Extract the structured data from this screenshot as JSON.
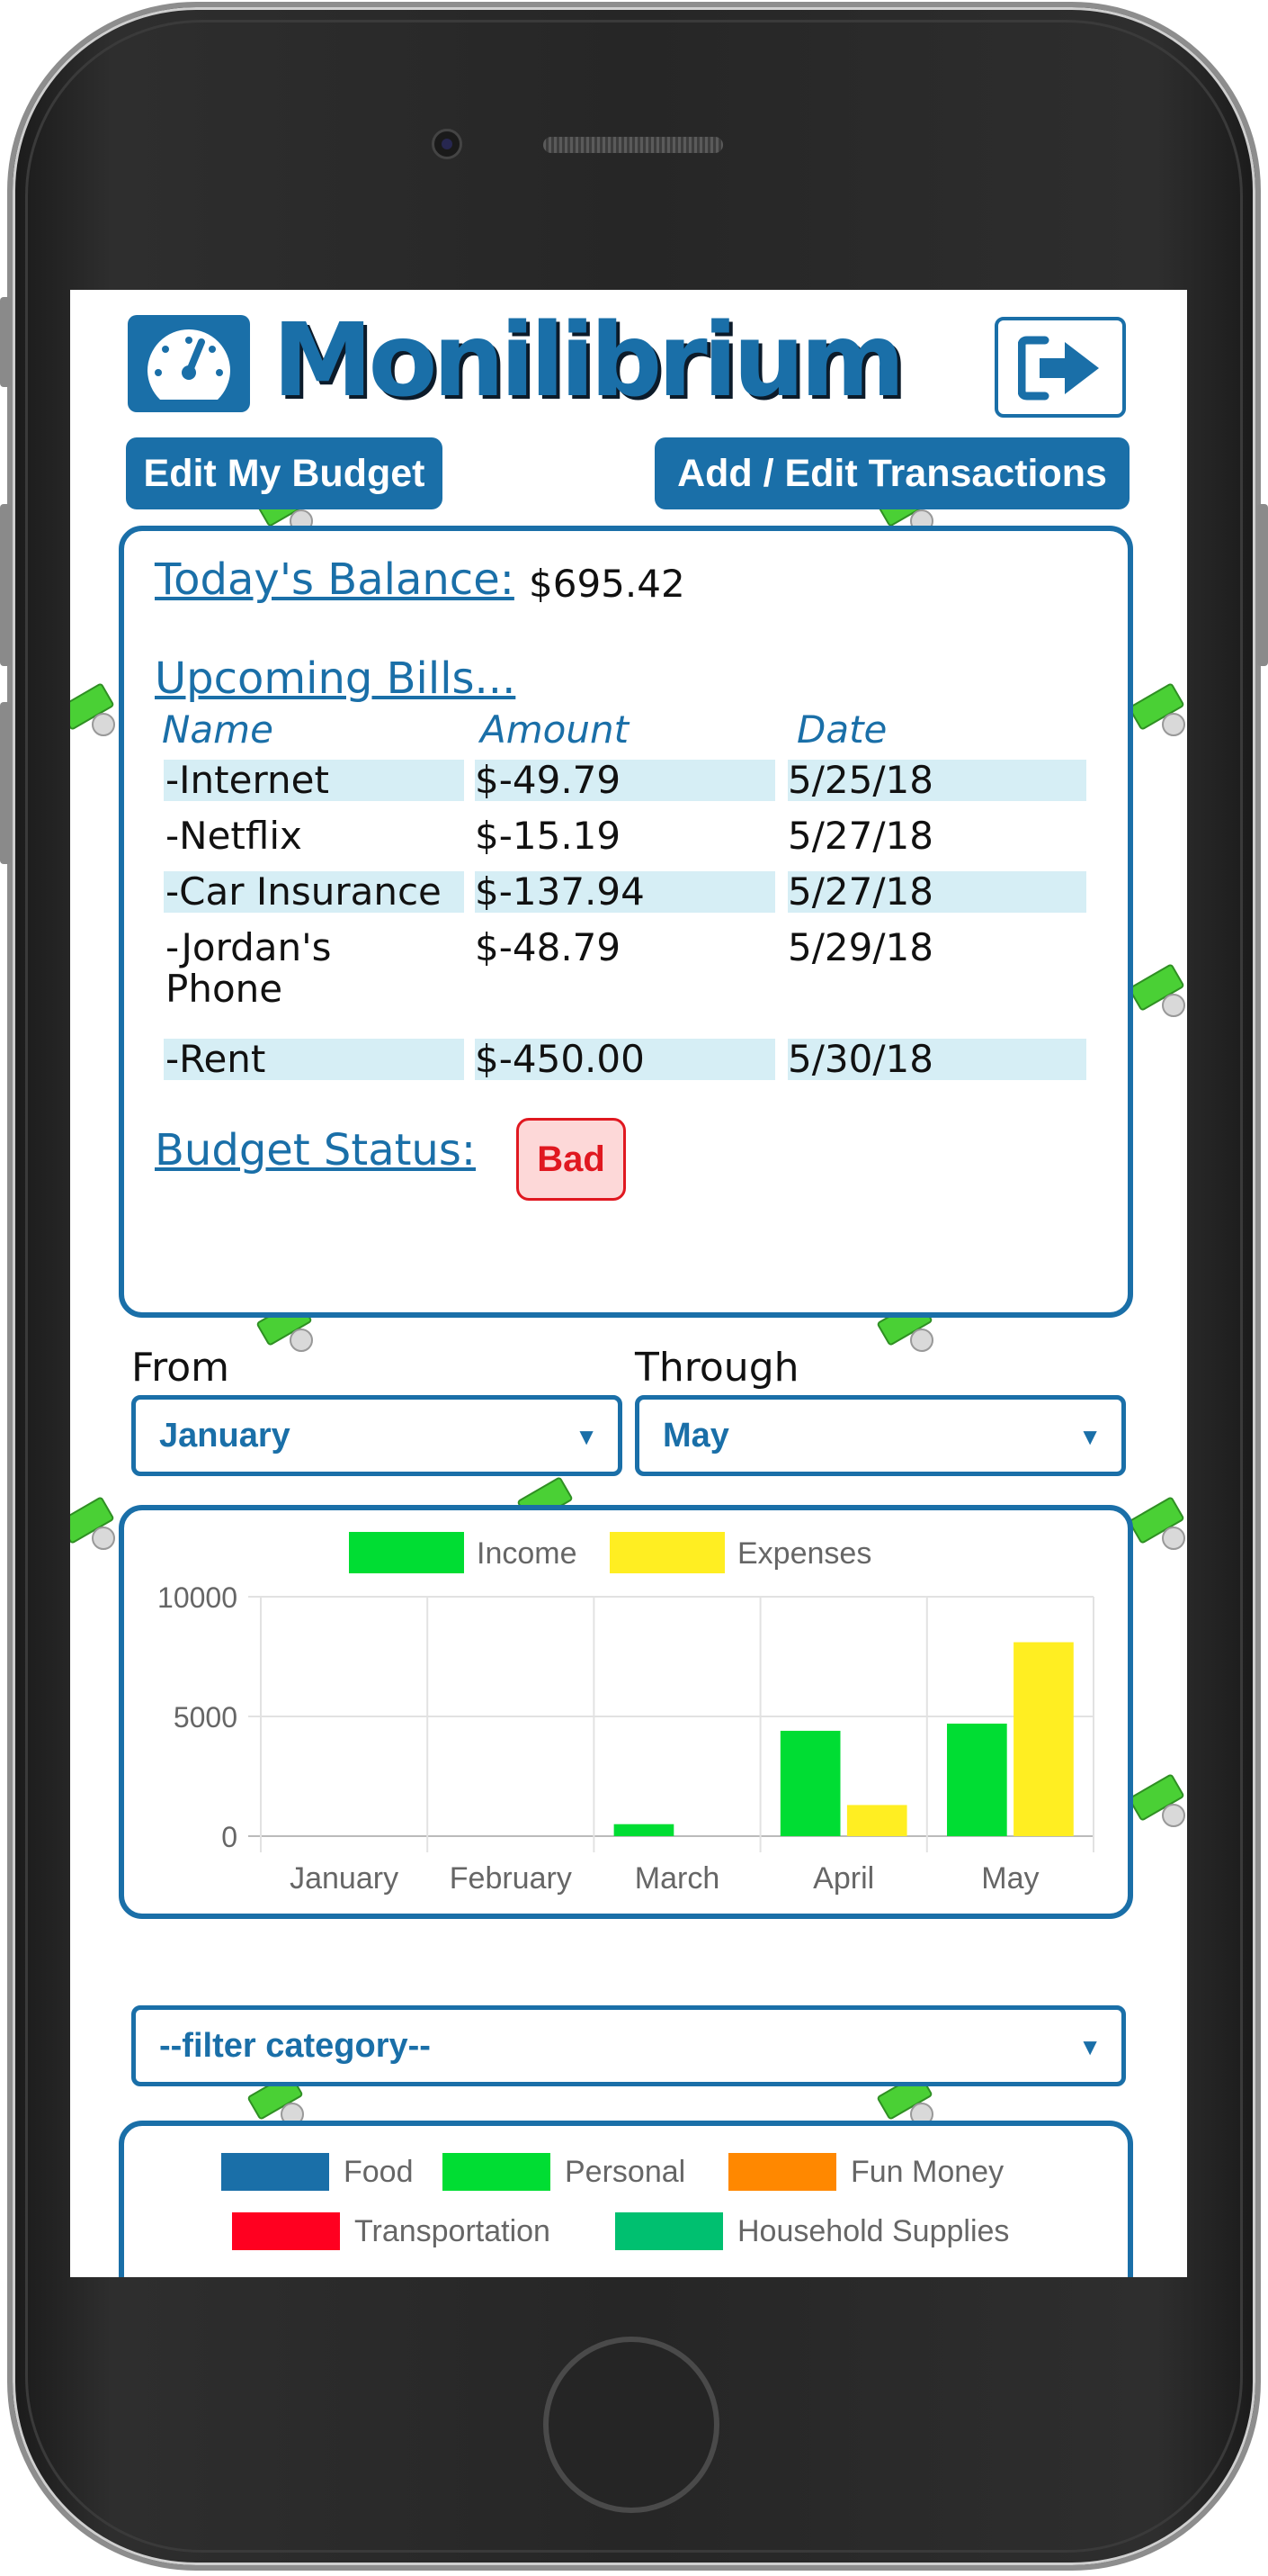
{
  "app": {
    "title": "Monilibrium"
  },
  "nav": {
    "edit_budget": "Edit My Budget",
    "transactions": "Add / Edit Transactions"
  },
  "summary": {
    "balance_label": "Today's Balance: ",
    "balance_value": "$695.42",
    "bills_label": "Upcoming Bills...",
    "columns": [
      "Name",
      "Amount",
      "Date"
    ],
    "bills": [
      {
        "name": "-Internet",
        "amount": "$-49.79",
        "date": "5/25/18"
      },
      {
        "name": "-Netflix",
        "amount": "$-15.19",
        "date": "5/27/18"
      },
      {
        "name": "-Car Insurance",
        "amount": "$-137.94",
        "date": "5/27/18"
      },
      {
        "name": "-Jordan's",
        "name2": "Phone",
        "amount": "$-48.79",
        "date": "5/29/18"
      },
      {
        "name": "-Rent",
        "amount": "$-450.00",
        "date": "5/30/18"
      }
    ],
    "status_label": "Budget Status: ",
    "status_value": "Bad"
  },
  "range": {
    "from_label": "From",
    "from_value": "January",
    "through_label": "Through",
    "through_value": "May"
  },
  "chart_data": {
    "type": "bar",
    "categories": [
      "January",
      "February",
      "March",
      "April",
      "May"
    ],
    "series": [
      {
        "name": "Income",
        "color": "#00dd33",
        "values": [
          0,
          0,
          500,
          4400,
          4700
        ]
      },
      {
        "name": "Expenses",
        "color": "#ffee22",
        "values": [
          0,
          0,
          0,
          1300,
          8100
        ]
      }
    ],
    "yticks": [
      "10000",
      "5000",
      "0"
    ],
    "ylim": [
      0,
      10000
    ],
    "grid": true,
    "legend": "top-center"
  },
  "category_filter": {
    "value": "--filter category--"
  },
  "category_legend": [
    {
      "name": "Food",
      "color": "#1a6fa8"
    },
    {
      "name": "Personal",
      "color": "#00dd33"
    },
    {
      "name": "Fun Money",
      "color": "#ff8800"
    },
    {
      "name": "Transportation",
      "color": "#ff0020"
    },
    {
      "name": "Household Supplies",
      "color": "#00c070"
    }
  ],
  "colors": {
    "accent": "#1a6fa8",
    "bad": "#e01820"
  }
}
